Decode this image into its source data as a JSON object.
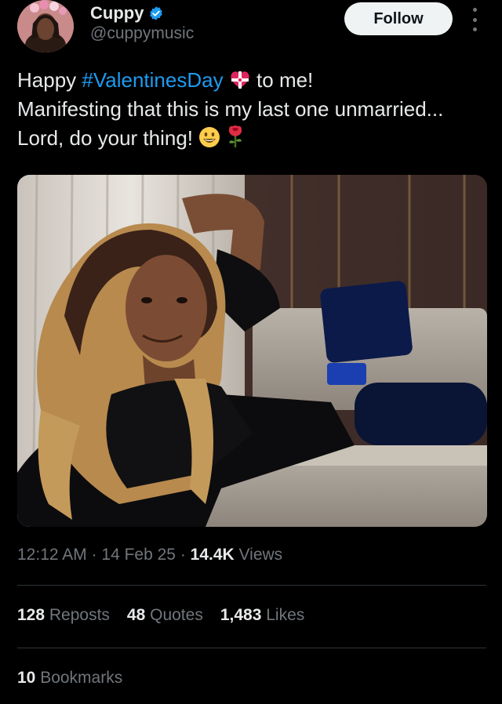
{
  "author": {
    "name": "Cuppy",
    "handle": "@cuppymusic",
    "verified": true,
    "verified_color": "#1d9bf0"
  },
  "actions": {
    "follow_label": "Follow",
    "more_icon": "more-vertical-icon"
  },
  "tweet": {
    "line1_prefix": "Happy ",
    "hashtag": "#ValentinesDay",
    "line1_suffix": " to me!",
    "line2": "Manifesting that this is my last one unmarried...",
    "line3": "Lord, do your thing! ",
    "emojis": [
      "heart-with-ribbon",
      "grinning-face",
      "rose"
    ]
  },
  "meta": {
    "time": "12:12 AM",
    "sep1": " · ",
    "date": "14 Feb 25",
    "sep2": " · ",
    "views_count": "14.4K",
    "views_label": " Views"
  },
  "stats": {
    "reposts_count": "128",
    "reposts_label": " Reposts",
    "quotes_count": "48",
    "quotes_label": " Quotes",
    "likes_count": "1,483",
    "likes_label": " Likes",
    "bookmarks_count": "10",
    "bookmarks_label": " Bookmarks"
  },
  "colors": {
    "background": "#000000",
    "text": "#e7e9ea",
    "muted": "#71767b",
    "link": "#1d9bf0",
    "divider": "#2f3336"
  }
}
